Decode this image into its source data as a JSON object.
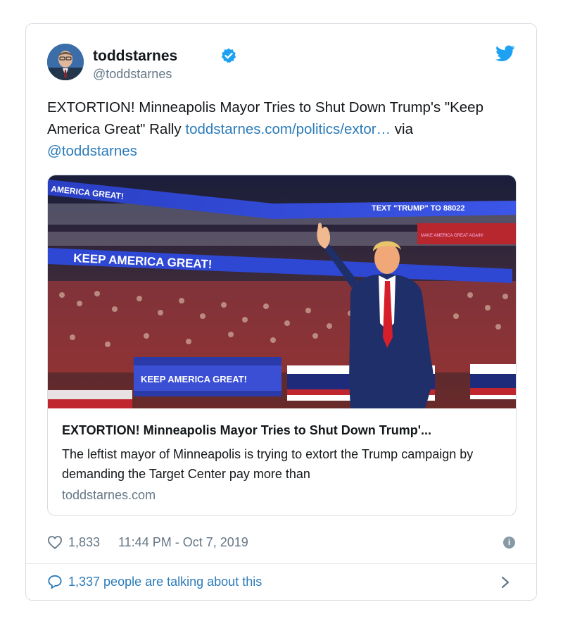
{
  "tweet": {
    "name": "toddstarnes",
    "handle": "@toddstarnes",
    "text_main": "EXTORTION! Minneapolis Mayor Tries to Shut Down Trump's \"Keep America Great\" Rally ",
    "link_text": "toddstarnes.com/politics/extor…",
    "text_via": " via ",
    "via_handle": "@toddstarnes",
    "icons": {
      "verified": "verified-badge-icon",
      "bird": "twitter-bird-icon"
    },
    "colors": {
      "link": "#2b7bb9",
      "muted": "#657786",
      "verified": "#1da1f2"
    }
  },
  "photo_banners": {
    "top_left": "AMERICA GREAT!",
    "top_right": "TEXT \"TRUMP\" TO 88022",
    "mid": "KEEP AMERICA GREAT!",
    "lower": "KEEP AMERICA GREAT!",
    "right_sign": "MAKE AMERICA GREAT AGAIN!"
  },
  "preview": {
    "title": "EXTORTION! Minneapolis Mayor Tries to Shut Down Trump'...",
    "description": "The leftist mayor of Minneapolis is trying to extort the Trump campaign by demanding the Target Center pay more than",
    "domain": "toddstarnes.com"
  },
  "meta": {
    "likes": "1,833",
    "timestamp": "11:44 PM - Oct 7, 2019",
    "info_glyph": "i"
  },
  "footer": {
    "talking": "1,337 people are talking about this"
  }
}
